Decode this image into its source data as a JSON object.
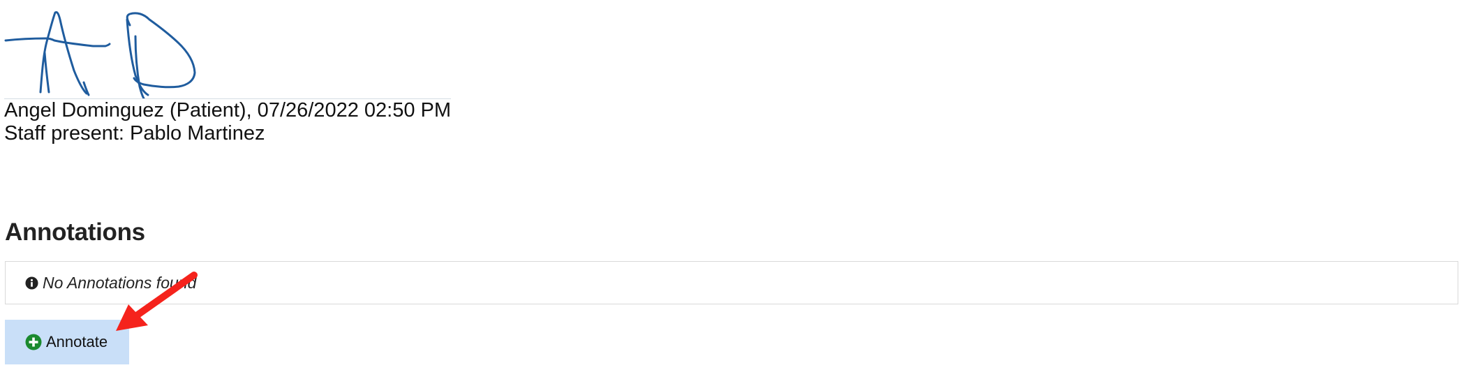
{
  "signature": {
    "signer_text": "Angel Dominguez (Patient), 07/26/2022 02:50 PM",
    "staff_text": "Staff present: Pablo Martinez",
    "ink_color": "#1f5c9e"
  },
  "annotations": {
    "heading": "Annotations",
    "empty_message": "No Annotations found",
    "info_icon": "info-circle-icon"
  },
  "annotate_button": {
    "label": "Annotate",
    "icon": "plus-circle-icon",
    "icon_color": "#1b8a2f",
    "background": "#c9dff8"
  },
  "overlay": {
    "arrow_color": "#f5231c"
  }
}
